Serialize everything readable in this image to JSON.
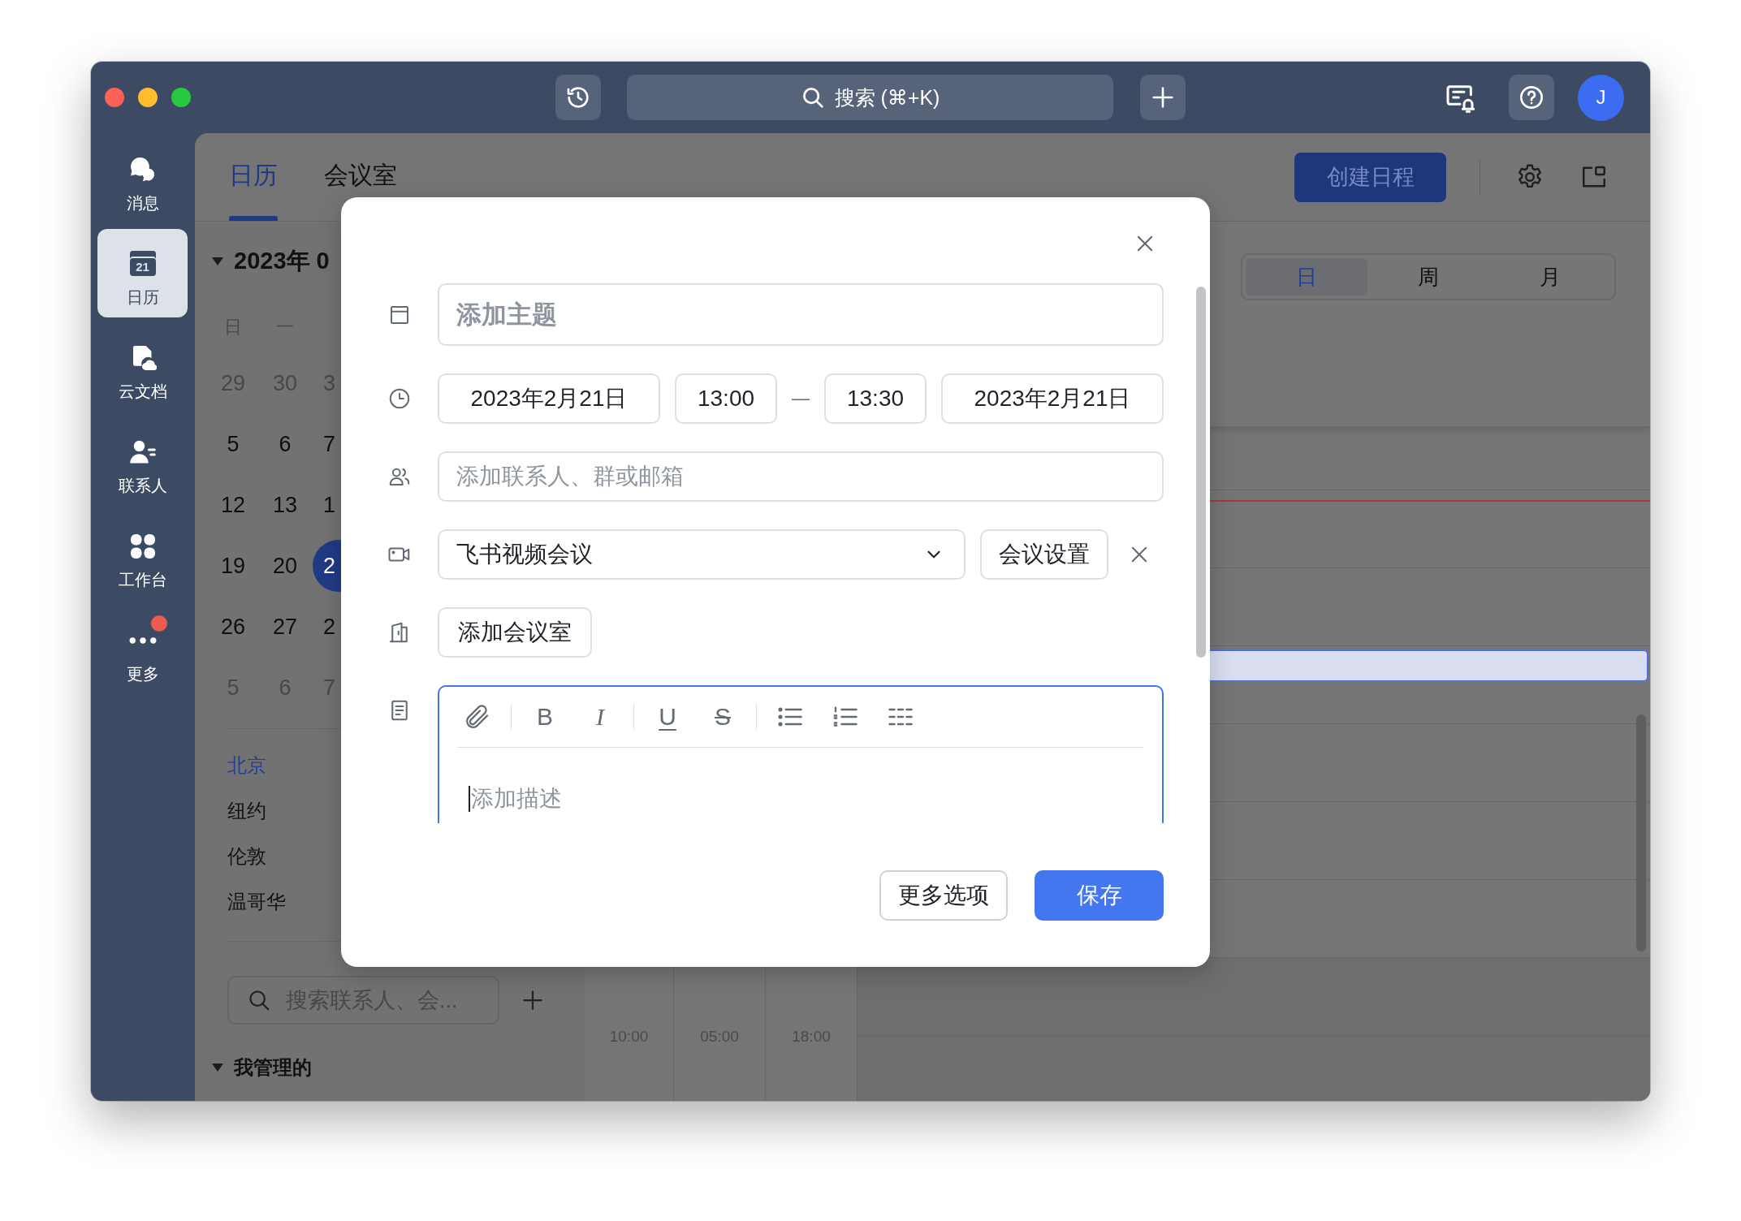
{
  "title_bar": {
    "search_button": "搜索 (⌘+K)",
    "avatar": "J"
  },
  "sidebar": {
    "items": [
      {
        "label": "消息",
        "selected": false,
        "badge": false
      },
      {
        "label": "日历",
        "selected": true,
        "badge": false,
        "icon_text": "21"
      },
      {
        "label": "云文档",
        "selected": false,
        "badge": false
      },
      {
        "label": "联系人",
        "selected": false,
        "badge": false
      },
      {
        "label": "工作台",
        "selected": false,
        "badge": false
      },
      {
        "label": "更多",
        "selected": false,
        "badge": true
      }
    ]
  },
  "tabs": [
    {
      "label": "日历",
      "selected": true
    },
    {
      "label": "会议室",
      "selected": false
    }
  ],
  "create_button": "创建日程",
  "mini_calendar": {
    "expanded": true,
    "month": "2023年 0",
    "weekdays": [
      "日",
      "一"
    ],
    "weeks": [
      [
        {
          "day": "29",
          "muted": true,
          "selected": false
        },
        {
          "day": "30",
          "muted": true,
          "selected": false
        },
        {
          "day": "3",
          "muted": true,
          "selected": false
        }
      ],
      [
        {
          "day": "5",
          "muted": false,
          "selected": false
        },
        {
          "day": "6",
          "muted": false,
          "selected": false
        },
        {
          "day": "7",
          "muted": false,
          "selected": false
        }
      ],
      [
        {
          "day": "12",
          "muted": false,
          "selected": false
        },
        {
          "day": "13",
          "muted": false,
          "selected": false
        },
        {
          "day": "1",
          "muted": false,
          "selected": false
        }
      ],
      [
        {
          "day": "19",
          "muted": false,
          "selected": false
        },
        {
          "day": "20",
          "muted": false,
          "selected": false
        },
        {
          "day": "2",
          "muted": false,
          "selected": true
        }
      ],
      [
        {
          "day": "26",
          "muted": false,
          "selected": false
        },
        {
          "day": "27",
          "muted": false,
          "selected": false
        },
        {
          "day": "2",
          "muted": false,
          "selected": false
        }
      ],
      [
        {
          "day": "5",
          "muted": true,
          "selected": false
        },
        {
          "day": "6",
          "muted": true,
          "selected": false
        },
        {
          "day": "7",
          "muted": true,
          "selected": false
        }
      ]
    ]
  },
  "cities": [
    {
      "label": "北京",
      "selected": true
    },
    {
      "label": "纽约",
      "selected": false
    },
    {
      "label": "伦敦",
      "selected": false
    },
    {
      "label": "温哥华",
      "selected": false
    }
  ],
  "contact_search": {
    "placeholder": "搜索联系人、会..."
  },
  "managed_calendars": {
    "label": "我管理的",
    "expanded": true
  },
  "view_switch": [
    {
      "label": "日",
      "selected": true
    },
    {
      "label": "周",
      "selected": false
    },
    {
      "label": "月",
      "selected": false
    }
  ],
  "time_axis": [
    "10:00",
    "05:00",
    "18:00"
  ],
  "dialog": {
    "title": {
      "placeholder": "添加主题"
    },
    "start_date": "2023年2月21日",
    "start_time": "13:00",
    "separator": "—",
    "end_time": "13:30",
    "end_date": "2023年2月21日",
    "attendees": {
      "placeholder": "添加联系人、群或邮箱"
    },
    "meeting": {
      "value": "飞书视频会议",
      "settings_button": "会议设置"
    },
    "room_button": "添加会议室",
    "editor": {
      "format_buttons": [
        {
          "label": "B",
          "kind": "bold"
        },
        {
          "label": "I",
          "kind": "italic"
        },
        {
          "label": "U",
          "kind": "underline"
        },
        {
          "label": "S",
          "kind": "strikethrough"
        }
      ],
      "placeholder": "添加描述"
    },
    "buttons": [
      {
        "label": "更多选项",
        "kind": "secondary"
      },
      {
        "label": "保存",
        "kind": "primary"
      }
    ]
  }
}
